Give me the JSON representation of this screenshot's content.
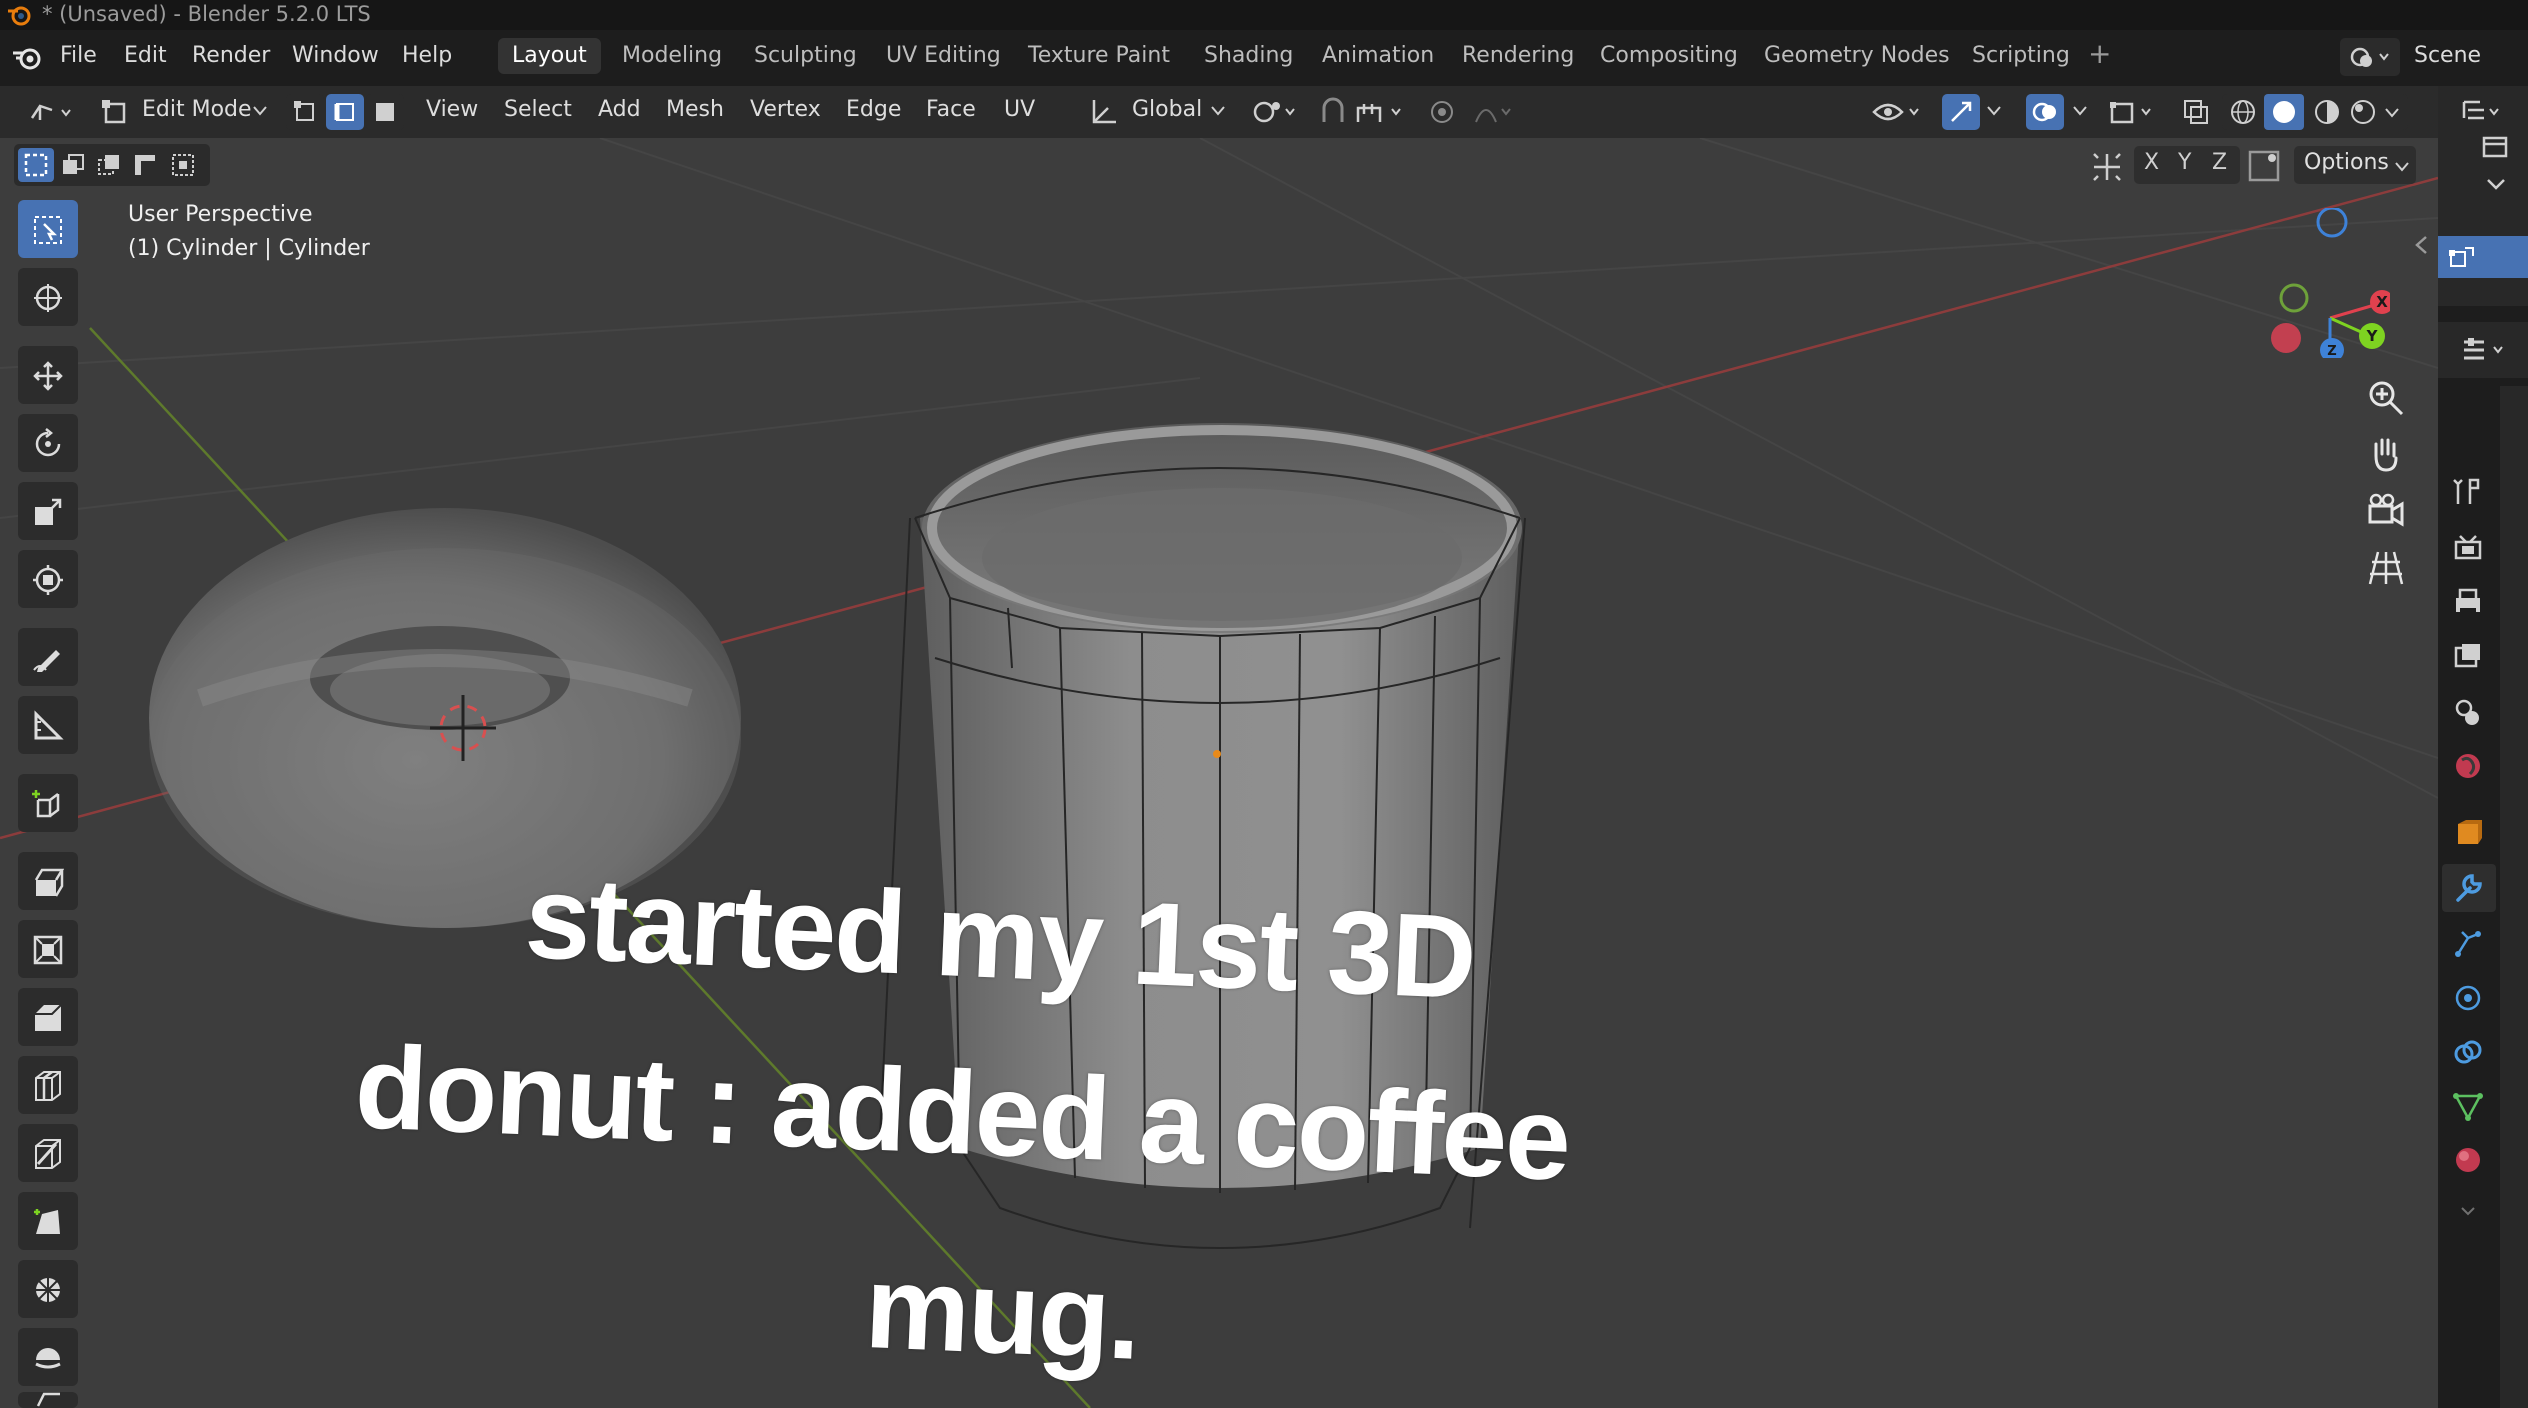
{
  "window": {
    "title": "* (Unsaved) - Blender 5.2.0 LTS"
  },
  "menu": {
    "items": [
      "File",
      "Edit",
      "Render",
      "Window",
      "Help"
    ]
  },
  "workspaces": {
    "tabs": [
      "Layout",
      "Modeling",
      "Sculpting",
      "UV Editing",
      "Texture Paint",
      "Shading",
      "Animation",
      "Rendering",
      "Compositing",
      "Geometry Nodes",
      "Scripting"
    ],
    "active": "Layout",
    "add": "+"
  },
  "scene": {
    "label": "Scene"
  },
  "header": {
    "mode": "Edit Mode",
    "menus": [
      "View",
      "Select",
      "Add",
      "Mesh",
      "Vertex",
      "Edge",
      "Face",
      "UV"
    ],
    "orientation": "Global",
    "options": "Options",
    "axes": [
      "X",
      "Y",
      "Z"
    ]
  },
  "viewport": {
    "perspective": "User Perspective",
    "object": "(1) Cylinder | Cylinder"
  },
  "gizmo": {
    "x": "X",
    "y": "Y",
    "z": "Z"
  },
  "caption": {
    "line1": "started my 1st 3D",
    "line2": "donut : added a coffee",
    "line3": "mug."
  },
  "colors": {
    "accent": "#4772b3",
    "x_axis": "#e0414e",
    "y_axis": "#7ed321",
    "z_axis": "#3e82d8"
  },
  "icons": {
    "tools": [
      "select-box",
      "cursor",
      "move",
      "rotate",
      "scale",
      "transform",
      "annotate",
      "measure",
      "add-cube",
      "extrude-region",
      "inset-faces",
      "bevel",
      "loop-cut",
      "knife",
      "poly-build",
      "spin",
      "smooth",
      "shear"
    ]
  }
}
